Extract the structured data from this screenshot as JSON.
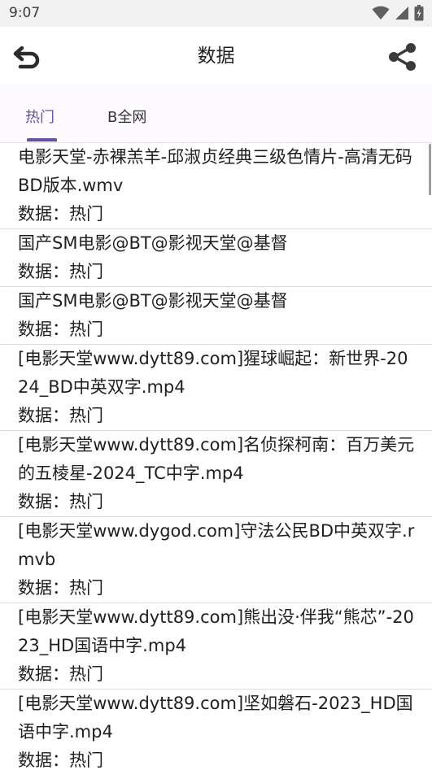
{
  "status_bar": {
    "time": "9:07",
    "icons": [
      "wifi-icon",
      "cell-signal-icon",
      "battery-charging-icon"
    ]
  },
  "app_bar": {
    "title": "数据",
    "back_icon": "back-arrow-icon",
    "share_icon": "share-icon"
  },
  "tabs": [
    {
      "label": "热门",
      "selected": true
    },
    {
      "label": "B全网",
      "selected": false
    }
  ],
  "colors": {
    "accent": "#6750a4",
    "status_bar_bg": "#f2f2f2",
    "tab_bar_bg": "#fdfaff",
    "divider": "#dcdcdc"
  },
  "items": [
    {
      "title": "电影天堂-赤裸羔羊-邱淑贞经典三级色情片-高清无码BD版本.wmv",
      "sub": "数据：热门"
    },
    {
      "title": "国产SM电影@BT@影视天堂@基督",
      "sub": "数据：热门"
    },
    {
      "title": "国产SM电影@BT@影视天堂@基督",
      "sub": "数据：热门"
    },
    {
      "title": "[电影天堂www.dytt89.com]猩球崛起：新世界-2024_BD中英双字.mp4",
      "sub": "数据：热门"
    },
    {
      "title": "[电影天堂www.dytt89.com]名侦探柯南：百万美元的五棱星-2024_TC中字.mp4",
      "sub": "数据：热门"
    },
    {
      "title": "[电影天堂www.dygod.com]守法公民BD中英双字.rmvb",
      "sub": "数据：热门"
    },
    {
      "title": "[电影天堂www.dytt89.com]熊出没·伴我“熊芯”-2023_HD国语中字.mp4",
      "sub": "数据：热门"
    },
    {
      "title": "[电影天堂www.dytt89.com]坚如磐石-2023_HD国语中字.mp4",
      "sub": "数据：热门"
    }
  ]
}
